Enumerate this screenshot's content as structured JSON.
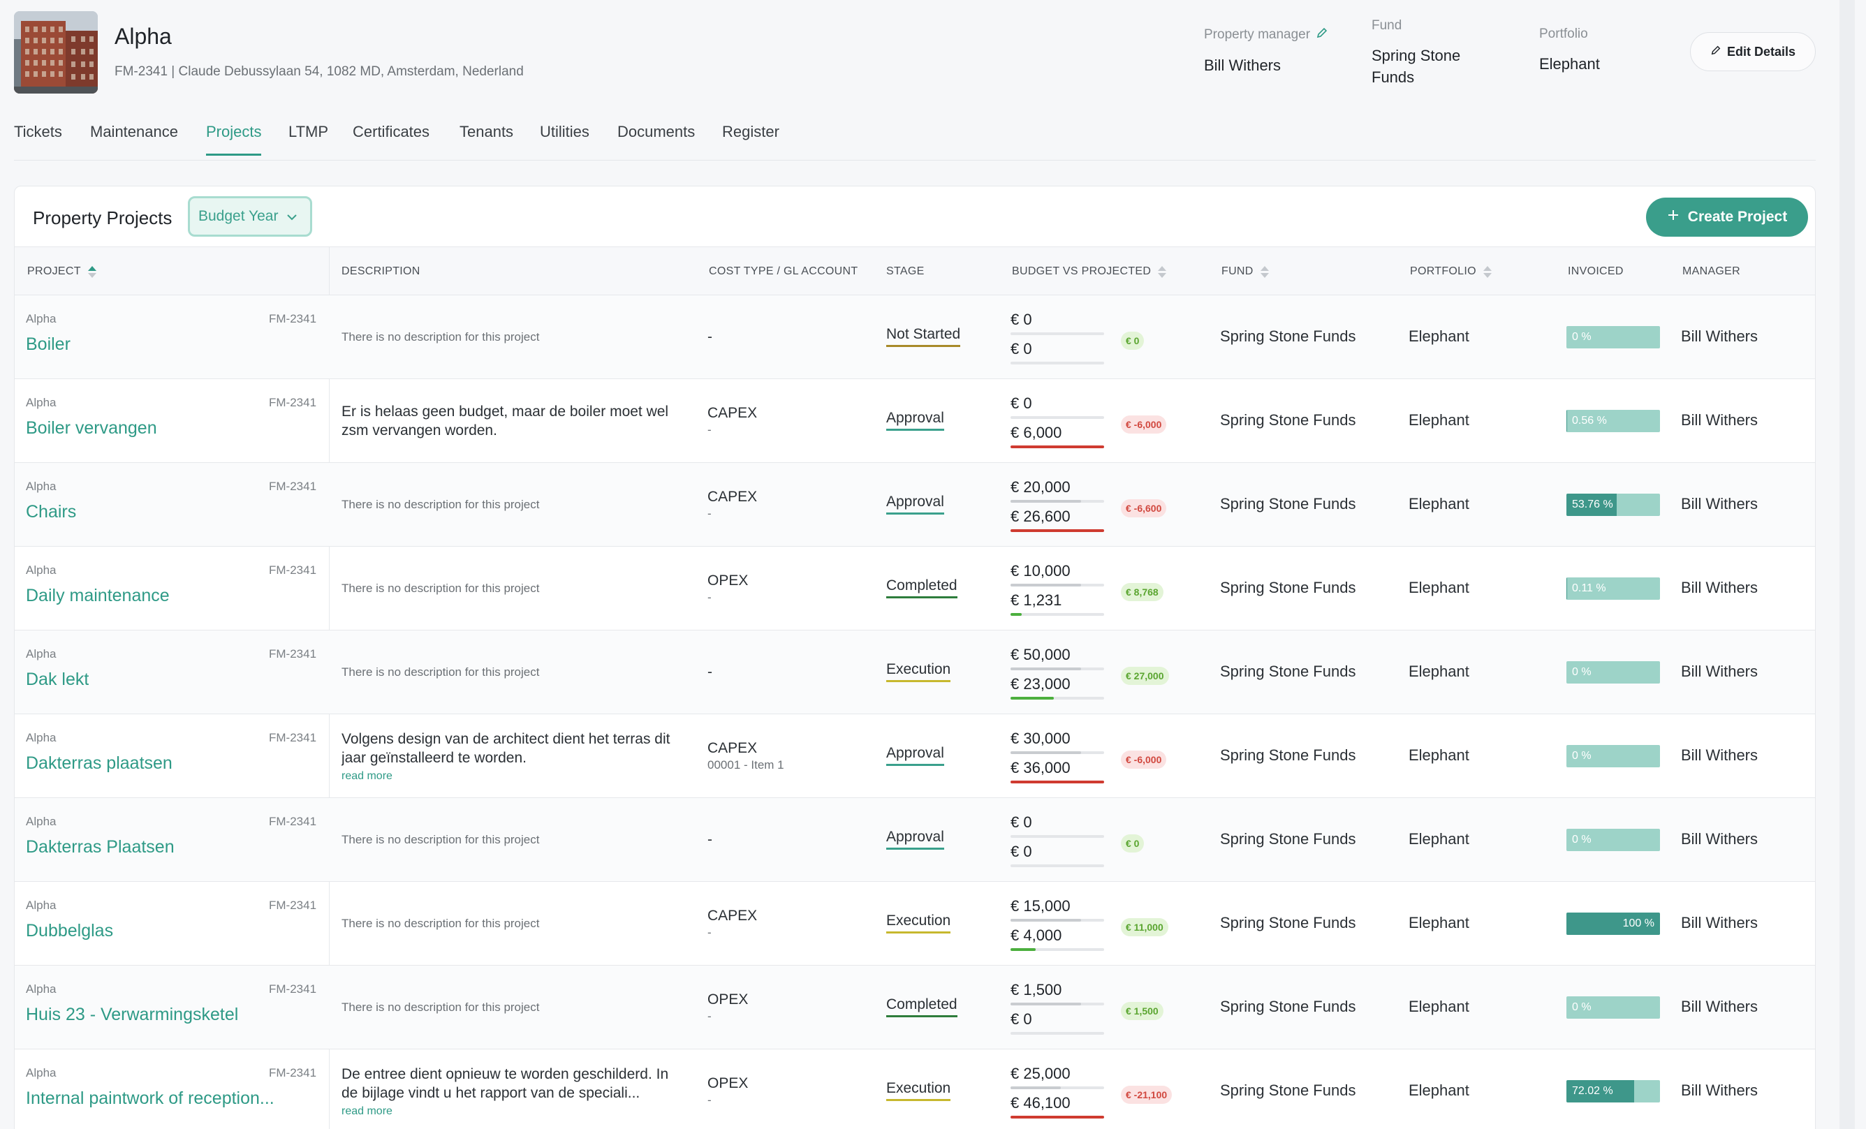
{
  "property": {
    "name": "Alpha",
    "subtitle": "FM-2341 | Claude Debussylaan 54, 1082 MD, Amsterdam, Nederland",
    "manager_label": "Property manager",
    "manager": "Bill Withers",
    "fund_label": "Fund",
    "fund": "Spring Stone Funds",
    "portfolio_label": "Portfolio",
    "portfolio": "Elephant",
    "edit_label": "Edit Details"
  },
  "tabs": [
    {
      "label": "Tickets"
    },
    {
      "label": "Maintenance"
    },
    {
      "label": "Projects",
      "active": true
    },
    {
      "label": "LTMP"
    },
    {
      "label": "Certificates"
    },
    {
      "label": "Tenants"
    },
    {
      "label": "Utilities"
    },
    {
      "label": "Documents"
    },
    {
      "label": "Register"
    }
  ],
  "projects_card": {
    "title": "Property Projects",
    "filter_label": "Budget Year",
    "create_label": "Create Project"
  },
  "columns": {
    "project": "PROJECT",
    "description": "DESCRIPTION",
    "cost": "COST TYPE / GL ACCOUNT",
    "stage": "STAGE",
    "budget": "BUDGET VS PROJECTED",
    "fund": "FUND",
    "portfolio": "PORTFOLIO",
    "invoiced": "INVOICED",
    "manager": "MANAGER"
  },
  "colors": {
    "accent": "#2e9a86",
    "stage_not_started": "#a88a2a",
    "stage_approval": "#3aa08c",
    "stage_completed": "#2e7d3c",
    "stage_execution": "#c7b82e",
    "over_budget": "#cf3b30",
    "under_budget": "#4caf3e",
    "invoice_fill": "#3e978a",
    "invoice_track": "#9dd3c8"
  },
  "rows": [
    {
      "location": "Alpha",
      "code": "FM-2341",
      "name": "Boiler",
      "description": "There is no description for this project",
      "has_description": false,
      "read_more": "",
      "cost_type": "-",
      "gl_account": "",
      "stage": "Not Started",
      "stage_key": "not_started",
      "budget": "€ 0",
      "projected": "€ 0",
      "budget_fill": 0,
      "projected_fill": 0,
      "over": false,
      "diff": "€ 0",
      "diff_type": "pos",
      "fund": "Spring Stone Funds",
      "portfolio": "Elephant",
      "invoiced": "0 %",
      "invoiced_pct": 0,
      "manager": "Bill Withers"
    },
    {
      "location": "Alpha",
      "code": "FM-2341",
      "name": "Boiler vervangen",
      "description": "Er is helaas geen budget, maar de boiler moet wel zsm vervangen worden.",
      "has_description": true,
      "read_more": "",
      "cost_type": "CAPEX",
      "gl_account": "-",
      "stage": "Approval",
      "stage_key": "approval",
      "budget": "€ 0",
      "projected": "€ 6,000",
      "budget_fill": 0,
      "projected_fill": 1,
      "over": true,
      "diff": "€ -6,000",
      "diff_type": "neg",
      "fund": "Spring Stone Funds",
      "portfolio": "Elephant",
      "invoiced": "0.56 %",
      "invoiced_pct": 0.56,
      "manager": "Bill Withers"
    },
    {
      "location": "Alpha",
      "code": "FM-2341",
      "name": "Chairs",
      "description": "There is no description for this project",
      "has_description": false,
      "read_more": "",
      "cost_type": "CAPEX",
      "gl_account": "-",
      "stage": "Approval",
      "stage_key": "approval",
      "budget": "€ 20,000",
      "projected": "€ 26,600",
      "budget_fill": 0.75,
      "projected_fill": 1,
      "over": true,
      "diff": "€ -6,600",
      "diff_type": "neg",
      "fund": "Spring Stone Funds",
      "portfolio": "Elephant",
      "invoiced": "53.76 %",
      "invoiced_pct": 53.76,
      "manager": "Bill Withers"
    },
    {
      "location": "Alpha",
      "code": "FM-2341",
      "name": "Daily maintenance",
      "description": "There is no description for this project",
      "has_description": false,
      "read_more": "",
      "cost_type": "OPEX",
      "gl_account": "-",
      "stage": "Completed",
      "stage_key": "completed",
      "budget": "€ 10,000",
      "projected": "€ 1,231",
      "budget_fill": 0.75,
      "projected_fill": 0.12,
      "over": false,
      "diff": "€ 8,768",
      "diff_type": "pos",
      "fund": "Spring Stone Funds",
      "portfolio": "Elephant",
      "invoiced": "0.11 %",
      "invoiced_pct": 0.11,
      "manager": "Bill Withers"
    },
    {
      "location": "Alpha",
      "code": "FM-2341",
      "name": "Dak lekt",
      "description": "There is no description for this project",
      "has_description": false,
      "read_more": "",
      "cost_type": "-",
      "gl_account": "",
      "stage": "Execution",
      "stage_key": "execution",
      "budget": "€ 50,000",
      "projected": "€ 23,000",
      "budget_fill": 0.75,
      "projected_fill": 0.46,
      "over": false,
      "diff": "€ 27,000",
      "diff_type": "pos",
      "fund": "Spring Stone Funds",
      "portfolio": "Elephant",
      "invoiced": "0 %",
      "invoiced_pct": 0,
      "manager": "Bill Withers"
    },
    {
      "location": "Alpha",
      "code": "FM-2341",
      "name": "Dakterras plaatsen",
      "description": "Volgens design van de architect dient het terras dit jaar geïnstalleerd te worden.",
      "has_description": true,
      "read_more": "read more",
      "cost_type": "CAPEX",
      "gl_account": "00001 - Item 1",
      "stage": "Approval",
      "stage_key": "approval",
      "budget": "€ 30,000",
      "projected": "€ 36,000",
      "budget_fill": 0.75,
      "projected_fill": 1,
      "over": true,
      "diff": "€ -6,000",
      "diff_type": "neg",
      "fund": "Spring Stone Funds",
      "portfolio": "Elephant",
      "invoiced": "0 %",
      "invoiced_pct": 0,
      "manager": "Bill Withers"
    },
    {
      "location": "Alpha",
      "code": "FM-2341",
      "name": "Dakterras Plaatsen",
      "description": "There is no description for this project",
      "has_description": false,
      "read_more": "",
      "cost_type": "-",
      "gl_account": "",
      "stage": "Approval",
      "stage_key": "approval",
      "budget": "€ 0",
      "projected": "€ 0",
      "budget_fill": 0,
      "projected_fill": 0,
      "over": false,
      "diff": "€ 0",
      "diff_type": "pos",
      "fund": "Spring Stone Funds",
      "portfolio": "Elephant",
      "invoiced": "0 %",
      "invoiced_pct": 0,
      "manager": "Bill Withers"
    },
    {
      "location": "Alpha",
      "code": "FM-2341",
      "name": "Dubbelglas",
      "description": "There is no description for this project",
      "has_description": false,
      "read_more": "",
      "cost_type": "CAPEX",
      "gl_account": "-",
      "stage": "Execution",
      "stage_key": "execution",
      "budget": "€ 15,000",
      "projected": "€ 4,000",
      "budget_fill": 0.75,
      "projected_fill": 0.27,
      "over": false,
      "diff": "€ 11,000",
      "diff_type": "pos",
      "fund": "Spring Stone Funds",
      "portfolio": "Elephant",
      "invoiced": "100 %",
      "invoiced_pct": 100,
      "manager": "Bill Withers"
    },
    {
      "location": "Alpha",
      "code": "FM-2341",
      "name": "Huis 23 - Verwarmingsketel",
      "description": "There is no description for this project",
      "has_description": false,
      "read_more": "",
      "cost_type": "OPEX",
      "gl_account": "-",
      "stage": "Completed",
      "stage_key": "completed",
      "budget": "€ 1,500",
      "projected": "€ 0",
      "budget_fill": 0.75,
      "projected_fill": 0,
      "over": false,
      "diff": "€ 1,500",
      "diff_type": "pos",
      "fund": "Spring Stone Funds",
      "portfolio": "Elephant",
      "invoiced": "0 %",
      "invoiced_pct": 0,
      "manager": "Bill Withers"
    },
    {
      "location": "Alpha",
      "code": "FM-2341",
      "name": "Internal paintwork of reception...",
      "description": "De entree dient opnieuw te worden geschilderd. In de bijlage vindt u het rapport van de speciali...",
      "has_description": true,
      "read_more": "read more",
      "cost_type": "OPEX",
      "gl_account": "-",
      "stage": "Execution",
      "stage_key": "execution",
      "budget": "€ 25,000",
      "projected": "€ 46,100",
      "budget_fill": 0.54,
      "projected_fill": 1,
      "over": true,
      "diff": "€ -21,100",
      "diff_type": "neg",
      "fund": "Spring Stone Funds",
      "portfolio": "Elephant",
      "invoiced": "72.02 %",
      "invoiced_pct": 72.02,
      "manager": "Bill Withers"
    }
  ]
}
